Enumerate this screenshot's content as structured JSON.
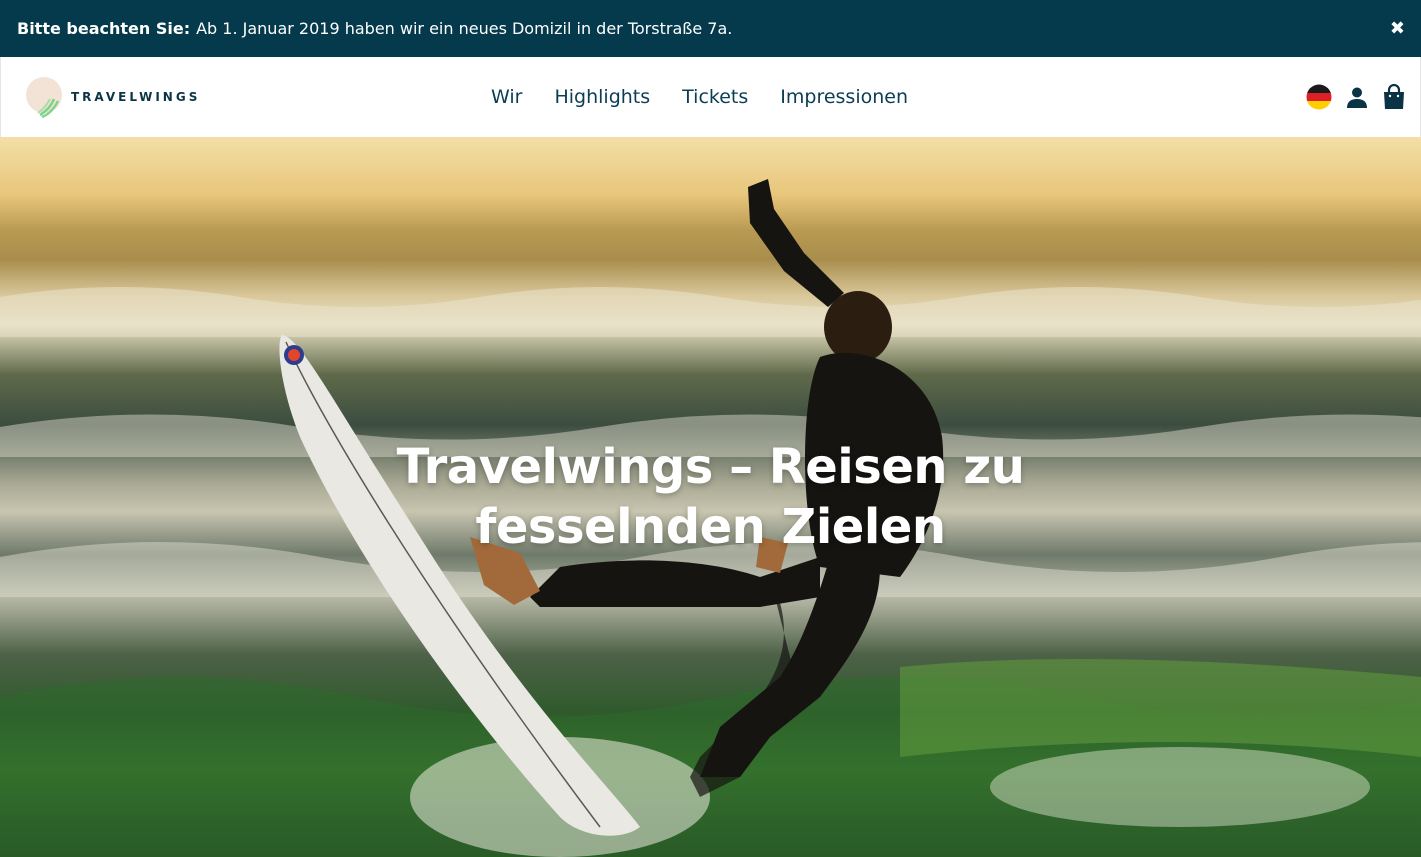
{
  "notice": {
    "lead": "Bitte beachten Sie:",
    "text": "Ab 1. Januar 2019 haben wir ein neues Domizil in der Torstraße 7a.",
    "close_icon": "close-icon"
  },
  "brand": {
    "name": "TRAVELWINGS",
    "logo_icon": "travelwings-logo"
  },
  "nav": {
    "items": [
      {
        "label": "Wir"
      },
      {
        "label": "Highlights"
      },
      {
        "label": "Tickets"
      },
      {
        "label": "Impressionen"
      }
    ]
  },
  "header_icons": {
    "language": "german-flag-icon",
    "account": "user-icon",
    "cart": "shopping-bag-icon"
  },
  "hero": {
    "title_line1": "Travelwings – Reisen zu",
    "title_line2": "fesselnden Zielen"
  },
  "colors": {
    "banner_bg": "#05394c",
    "nav_text": "#0b3d55",
    "white": "#ffffff"
  }
}
